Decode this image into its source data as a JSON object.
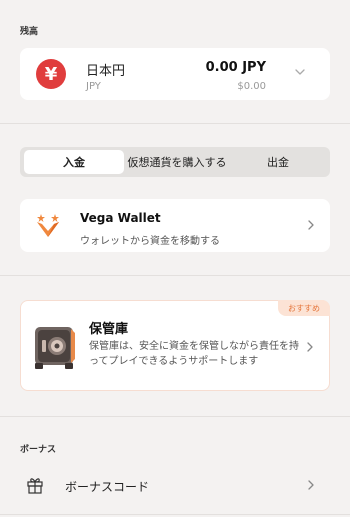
{
  "balance_section": {
    "label": "残高",
    "currency_name": "日本円",
    "currency_code": "JPY",
    "currency_symbol": "¥",
    "amount": "0.00 JPY",
    "fiat_value": "$0.00"
  },
  "tabs": [
    {
      "label": "入金",
      "active": true
    },
    {
      "label": "仮想通貨を購入する",
      "active": false
    },
    {
      "label": "出金",
      "active": false
    }
  ],
  "vega_wallet": {
    "title": "Vega Wallet",
    "subtitle": "ウォレットから資金を移動する"
  },
  "vault": {
    "badge": "おすすめ",
    "title": "保管庫",
    "description": "保管庫は、安全に資金を保管しながら責任を持ってプレイできるようサポートします"
  },
  "bonus_section": {
    "label": "ボーナス",
    "code_label": "ボーナスコード"
  },
  "colors": {
    "background": "#f4f2f1",
    "card": "#ffffff",
    "yen_red": "#e03d3d",
    "vega_orange": "#f0883e",
    "badge_bg": "#fce3d5",
    "badge_text": "#e5763c"
  },
  "icons": {
    "currency": "yen-icon",
    "dropdown": "chevron-down-icon",
    "vega": "vega-logo-icon",
    "vault": "vault-icon",
    "bonus": "gift-icon",
    "navigate": "chevron-right-icon"
  }
}
